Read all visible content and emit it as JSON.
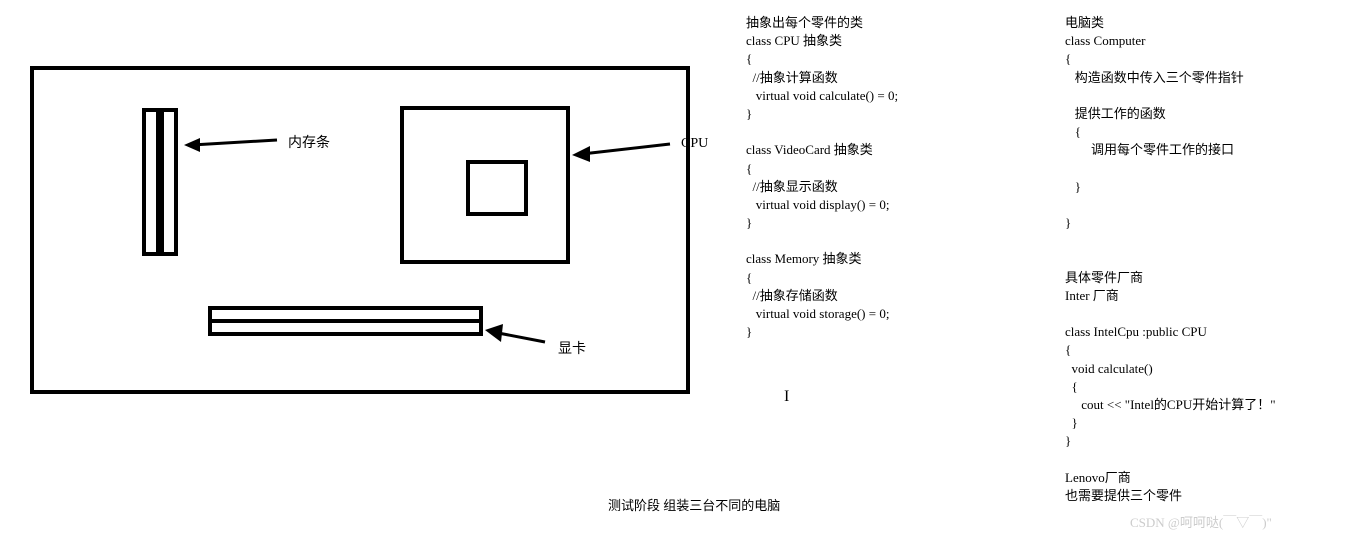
{
  "labels": {
    "memory": "内存条",
    "cpu": "CPU",
    "gpu": "显卡"
  },
  "code_mid": {
    "l0": "抽象出每个零件的类",
    "l1": "class CPU 抽象类",
    "l2": "{",
    "l3": "  //抽象计算函数",
    "l4": "   virtual void calculate() = 0;",
    "l5": "}",
    "l6": "",
    "l7": "class VideoCard 抽象类",
    "l8": "{",
    "l9": "  //抽象显示函数",
    "l10": "   virtual void display() = 0;",
    "l11": "}",
    "l12": "",
    "l13": "class Memory 抽象类",
    "l14": "{",
    "l15": "  //抽象存储函数",
    "l16": "   virtual void storage() = 0;",
    "l17": "}"
  },
  "code_right": {
    "l0": "电脑类",
    "l1": "class Computer",
    "l2": "{",
    "l3": "   构造函数中传入三个零件指针",
    "l4": "",
    "l5": "   提供工作的函数",
    "l6": "   {",
    "l7": "        调用每个零件工作的接口",
    "l8": "",
    "l9": "   }",
    "l10": "",
    "l11": "}",
    "l12": "",
    "l13": "",
    "l14": "具体零件厂商",
    "l15": "Inter 厂商",
    "l16": "",
    "l17": "class IntelCpu :public CPU",
    "l18": "{",
    "l19": "  void calculate()",
    "l20": "  {",
    "l21": "     cout << \"Intel的CPU开始计算了！\"",
    "l22": "  }",
    "l23": "}",
    "l24": "",
    "l25": "Lenovo厂商",
    "l26": "也需要提供三个零件"
  },
  "test_phase": "测试阶段 组装三台不同的电脑",
  "watermark": "CSDN @呵呵哒(￣▽￣)\""
}
